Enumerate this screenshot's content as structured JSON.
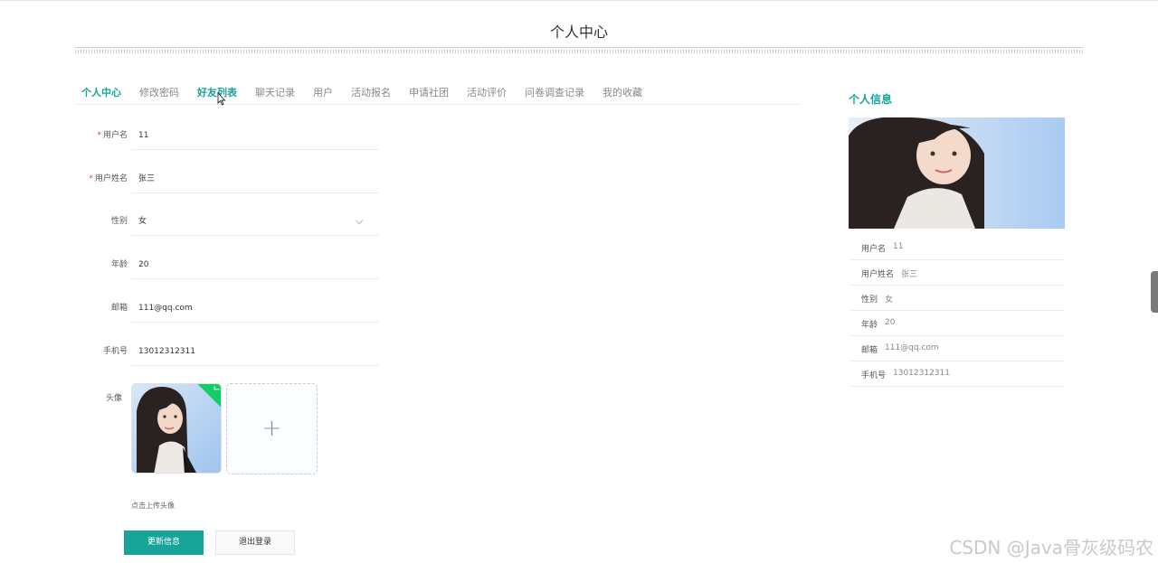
{
  "page": {
    "title": "个人中心"
  },
  "tabs": [
    {
      "label": "个人中心",
      "active": true
    },
    {
      "label": "修改密码"
    },
    {
      "label": "好友列表",
      "active": true
    },
    {
      "label": "聊天记录"
    },
    {
      "label": "用户"
    },
    {
      "label": "活动报名"
    },
    {
      "label": "申请社团"
    },
    {
      "label": "活动评价"
    },
    {
      "label": "问卷调查记录"
    },
    {
      "label": "我的收藏"
    }
  ],
  "form": {
    "username": {
      "label": "用户名",
      "value": "11",
      "required": true
    },
    "realname": {
      "label": "用户姓名",
      "value": "张三",
      "required": true
    },
    "gender": {
      "label": "性别",
      "value": "女"
    },
    "age": {
      "label": "年龄",
      "value": "20"
    },
    "email": {
      "label": "邮箱",
      "value": "111@qq.com"
    },
    "phone": {
      "label": "手机号",
      "value": "13012312311"
    },
    "avatar": {
      "label": "头像",
      "hint": "点击上传头像",
      "plus": "+"
    },
    "required_mark": "*"
  },
  "buttons": {
    "update": "更新信息",
    "logout": "退出登录"
  },
  "sidebar": {
    "title": "个人信息",
    "rows": [
      {
        "key": "用户名",
        "value": "11"
      },
      {
        "key": "用户姓名",
        "value": "张三"
      },
      {
        "key": "性别",
        "value": "女"
      },
      {
        "key": "年龄",
        "value": "20"
      },
      {
        "key": "邮箱",
        "value": "111@qq.com"
      },
      {
        "key": "手机号",
        "value": "13012312311"
      }
    ]
  },
  "colors": {
    "accent": "#18a499",
    "success": "#13ce66",
    "required": "#e64242"
  },
  "watermark": "CSDN @Java骨灰级码农"
}
